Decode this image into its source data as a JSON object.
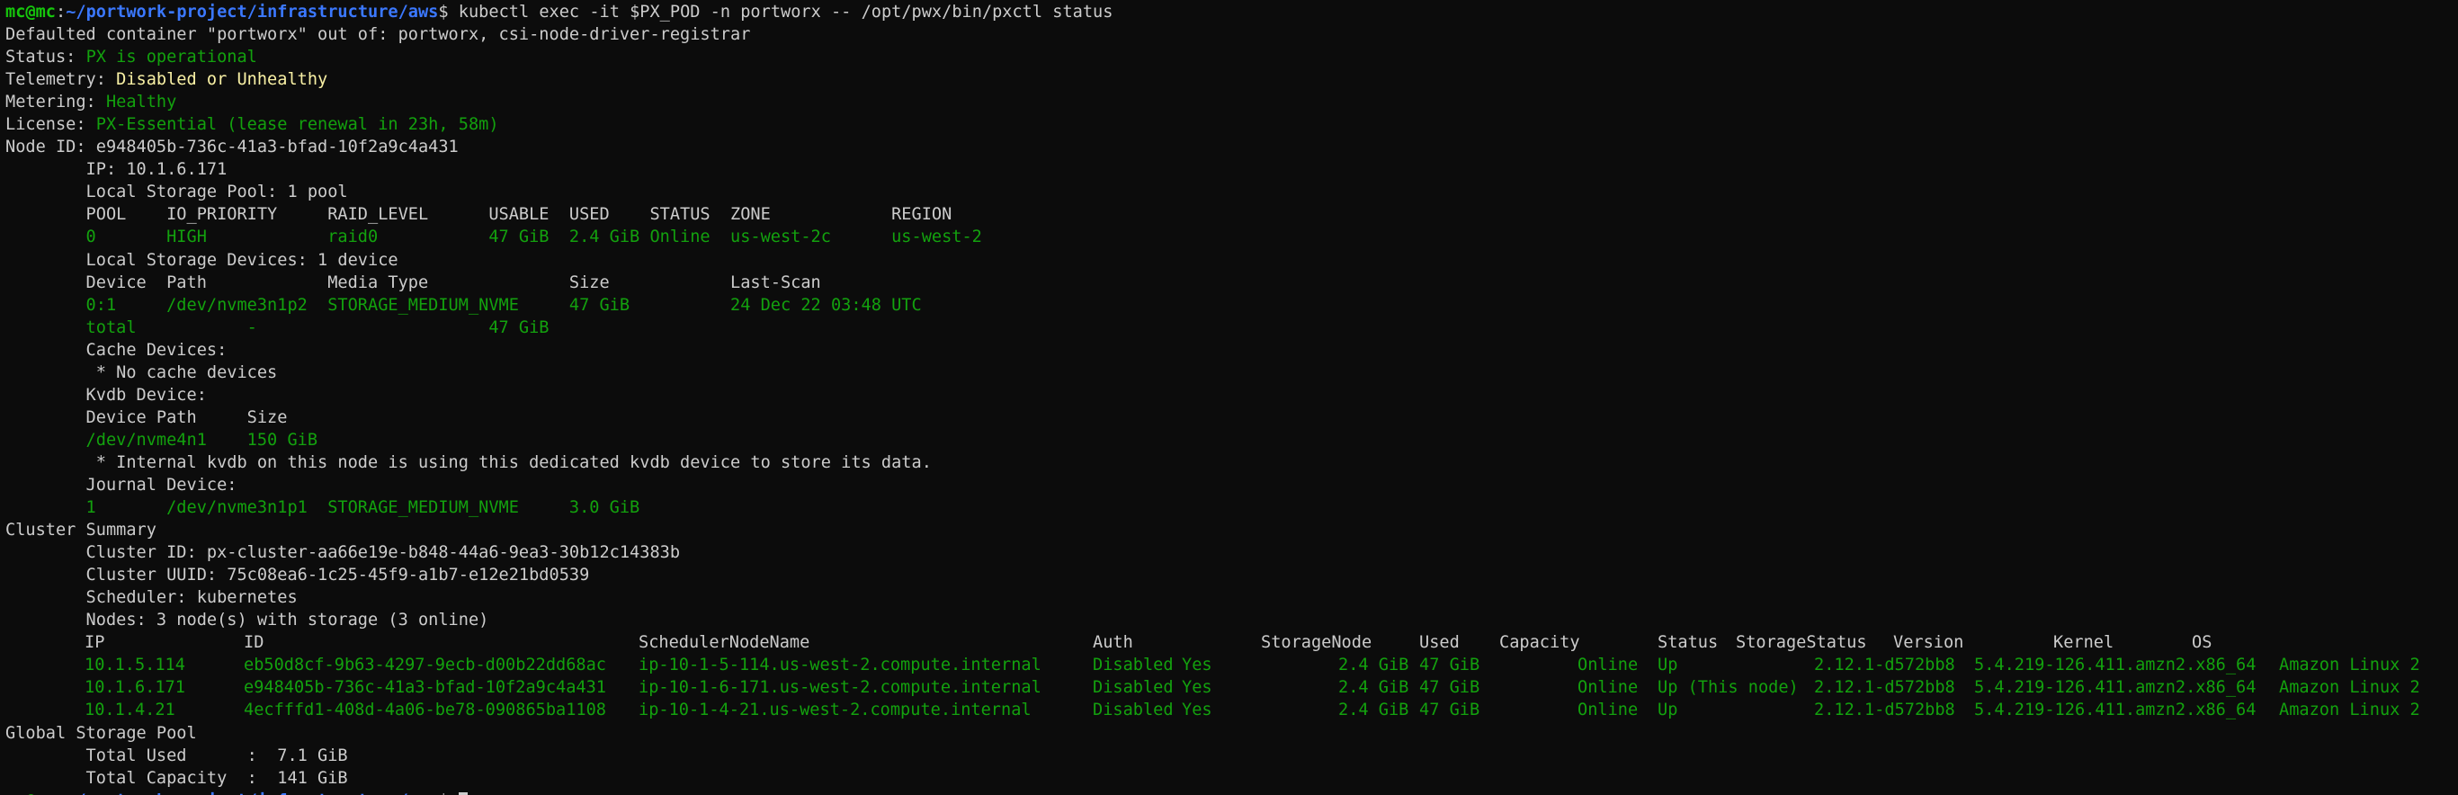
{
  "prompt": {
    "user_host": "mc@mc",
    "sep": ":",
    "path": "~/portwork-project/infrastructure/aws",
    "symbol": "$",
    "command": " kubectl exec -it $PX_POD -n portworx -- /opt/pwx/bin/pxctl status"
  },
  "output": {
    "defaulted": "Defaulted container \"portworx\" out of: portworx, csi-node-driver-registrar",
    "status_label": "Status: ",
    "status_value": "PX is operational",
    "telemetry_label": "Telemetry: ",
    "telemetry_value": "Disabled or Unhealthy",
    "metering_label": "Metering: ",
    "metering_value": "Healthy",
    "license_label": "License: ",
    "license_value": "PX-Essential (lease renewal in 23h, 58m)",
    "node_id": "Node ID: e948405b-736c-41a3-bfad-10f2a9c4a431",
    "ip": "        IP: 10.1.6.171",
    "local_pool": "        Local Storage Pool: 1 pool",
    "pool_header": "        POOL    IO_PRIORITY     RAID_LEVEL      USABLE  USED    STATUS  ZONE            REGION",
    "pool_row": "        0       HIGH            raid0           47 GiB  2.4 GiB Online  us-west-2c      us-west-2",
    "local_devices": "        Local Storage Devices: 1 device",
    "dev_header": "        Device  Path            Media Type              Size            Last-Scan",
    "dev_row": "        0:1     /dev/nvme3n1p2  STORAGE_MEDIUM_NVME     47 GiB          24 Dec 22 03:48 UTC",
    "dev_total": "        total           -                       47 GiB",
    "cache_devices": "        Cache Devices:",
    "no_cache": "         * No cache devices",
    "kvdb_device": "        Kvdb Device:",
    "kvdb_header": "        Device Path     Size",
    "kvdb_row": "        /dev/nvme4n1    150 GiB",
    "kvdb_note": "         * Internal kvdb on this node is using this dedicated kvdb device to store its data.",
    "journal_device": "        Journal Device:",
    "journal_row": "        1       /dev/nvme3n1p1  STORAGE_MEDIUM_NVME     3.0 GiB",
    "cluster_summary": "Cluster Summary",
    "cluster_id": "        Cluster ID: px-cluster-aa66e19e-b848-44a6-9ea3-30b12c14383b",
    "cluster_uuid": "        Cluster UUID: 75c08ea6-1c25-45f9-a1b7-e12e21bd0539",
    "scheduler": "        Scheduler: kubernetes",
    "nodes": "        Nodes: 3 node(s) with storage (3 online)",
    "global_pool": "Global Storage Pool",
    "total_used": "        Total Used      :  7.1 GiB",
    "total_capacity": "        Total Capacity  :  141 GiB"
  },
  "node_table": {
    "headers": {
      "ip": "IP",
      "id": "ID",
      "sched": "SchedulerNodeName",
      "auth": "Auth",
      "storage_node": "StorageNode",
      "used": "Used",
      "capacity": "Capacity",
      "status": "Status",
      "storage_status": "StorageStatus",
      "version": "Version",
      "kernel": "Kernel",
      "os": "OS"
    },
    "rows": [
      {
        "ip": "10.1.5.114",
        "id": "eb50d8cf-9b63-4297-9ecb-d00b22dd68ac",
        "sched": "ip-10-1-5-114.us-west-2.compute.internal",
        "auth": "Disabled",
        "storage_node": "Yes",
        "used": "2.4 GiB",
        "capacity": "47 GiB",
        "status": "Online",
        "storage_status": "Up",
        "version": "2.12.1-d572bb8",
        "kernel": "5.4.219-126.411.amzn2.x86_64",
        "os": "Amazon Linux 2"
      },
      {
        "ip": "10.1.6.171",
        "id": "e948405b-736c-41a3-bfad-10f2a9c4a431",
        "sched": "ip-10-1-6-171.us-west-2.compute.internal",
        "auth": "Disabled",
        "storage_node": "Yes",
        "used": "2.4 GiB",
        "capacity": "47 GiB",
        "status": "Online",
        "storage_status": "Up (This node)",
        "version": "2.12.1-d572bb8",
        "kernel": "5.4.219-126.411.amzn2.x86_64",
        "os": "Amazon Linux 2"
      },
      {
        "ip": "10.1.4.21",
        "id": "4ecfffd1-408d-4a06-be78-090865ba1108",
        "sched": "ip-10-1-4-21.us-west-2.compute.internal",
        "auth": "Disabled",
        "storage_node": "Yes",
        "used": "2.4 GiB",
        "capacity": "47 GiB",
        "status": "Online",
        "storage_status": "Up",
        "version": "2.12.1-d572bb8",
        "kernel": "5.4.219-126.411.amzn2.x86_64",
        "os": "Amazon Linux 2"
      }
    ]
  },
  "colors": {
    "background": "#0c0c0c",
    "foreground": "#cccccc",
    "prompt_green": "#16c60c",
    "path_blue": "#3b78ff",
    "value_green": "#13a10e",
    "warning_yellow": "#f9f1a5"
  }
}
